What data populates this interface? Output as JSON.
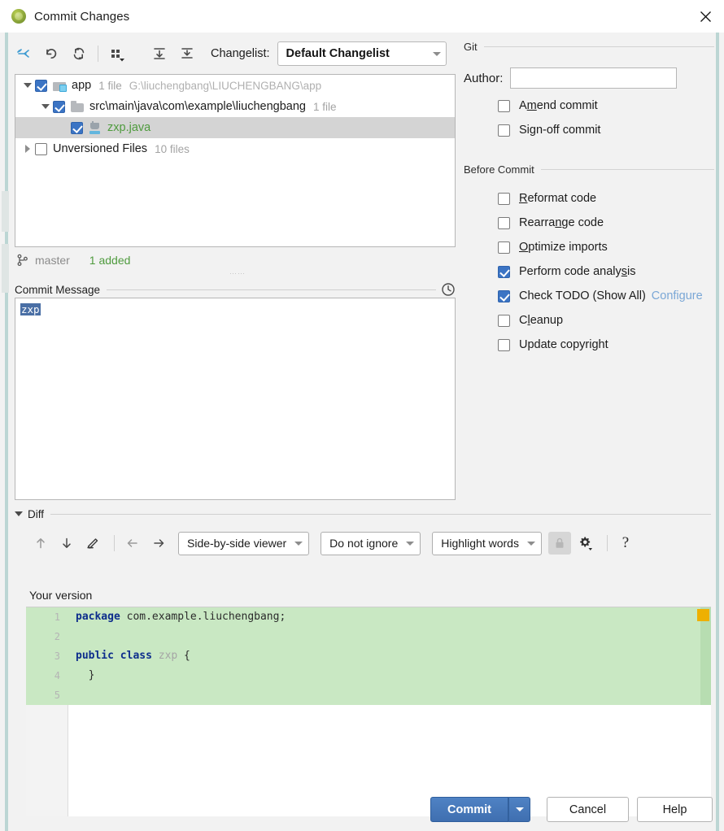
{
  "window": {
    "title": "Commit Changes",
    "app_icon": "intellij-idea-icon",
    "close_icon": "close-icon"
  },
  "toolbar": {
    "buttons": [
      {
        "name": "move-to-another-changelist-icon",
        "tooltip": "Move to Another Changelist"
      },
      {
        "name": "rollback-icon",
        "tooltip": "Rollback"
      },
      {
        "name": "refresh-icon",
        "tooltip": "Refresh"
      },
      {
        "name": "group-by-icon",
        "tooltip": "Group By"
      },
      {
        "name": "expand-all-icon",
        "tooltip": "Expand All"
      },
      {
        "name": "collapse-all-icon",
        "tooltip": "Collapse All"
      }
    ],
    "changelist_label": "Changelist:",
    "changelist_value": "Default Changelist"
  },
  "tree": {
    "rows": [
      {
        "indent": 0,
        "expander": "down",
        "checked": true,
        "icon": "module-folder-icon",
        "name": "app",
        "meta": "1 file",
        "path": "G:\\liuchengbang\\LIUCHENGBANG\\app",
        "selected": false,
        "added": false
      },
      {
        "indent": 1,
        "expander": "down",
        "checked": true,
        "icon": "folder-icon",
        "name": "src\\main\\java\\com\\example\\liuchengbang",
        "meta": "1 file",
        "path": "",
        "selected": false,
        "added": false
      },
      {
        "indent": 2,
        "expander": "none",
        "checked": true,
        "icon": "java-file-icon",
        "name": "zxp.java",
        "meta": "",
        "path": "",
        "selected": true,
        "added": true
      },
      {
        "indent": 0,
        "expander": "right",
        "checked": false,
        "icon": "none",
        "name": "Unversioned Files",
        "meta": "10 files",
        "path": "",
        "selected": false,
        "added": false
      }
    ]
  },
  "branch_status": {
    "icon": "git-branch-icon",
    "branch": "master",
    "added": "1 added"
  },
  "commit_message": {
    "label": "Commit Message",
    "history_icon": "clock-history-icon",
    "value": "zxp",
    "selected": true
  },
  "git_section": {
    "title": "Git",
    "author_label": "Author:",
    "author_value": "",
    "options": [
      {
        "name": "amend-commit",
        "label": "A<u>m</u>end commit",
        "checked": false
      },
      {
        "name": "sign-off-commit",
        "label": "Sign-off commit",
        "checked": false
      }
    ]
  },
  "before_commit_section": {
    "title": "Before Commit",
    "options": [
      {
        "name": "reformat-code",
        "label": "<u>R</u>eformat code",
        "checked": false,
        "link": ""
      },
      {
        "name": "rearrange-code",
        "label": "Rearra<u>n</u>ge code",
        "checked": false,
        "link": ""
      },
      {
        "name": "optimize-imports",
        "label": "<u>O</u>ptimize imports",
        "checked": false,
        "link": ""
      },
      {
        "name": "perform-code-analysis",
        "label": "Perform code analy<u>s</u>is",
        "checked": true,
        "link": ""
      },
      {
        "name": "check-todo",
        "label": "Check TODO (Show All)",
        "checked": true,
        "link": "Configure"
      },
      {
        "name": "cleanup",
        "label": "C<u>l</u>eanup",
        "checked": false,
        "link": ""
      },
      {
        "name": "update-copyright",
        "label": "Update copyright",
        "checked": false,
        "link": ""
      }
    ]
  },
  "diff": {
    "section_title": "Diff",
    "toolbar": {
      "prev_diff_icon": "arrow-up-icon",
      "next_diff_icon": "arrow-down-icon",
      "edit_icon": "pencil-icon",
      "apply_left_icon": "arrow-left-icon",
      "apply_right_icon": "arrow-right-icon",
      "viewer_mode": "Side-by-side viewer",
      "ignore_mode": "Do not ignore",
      "highlight_mode": "Highlight words",
      "lock_icon": "lock-icon",
      "settings_icon": "gear-icon",
      "help_icon": "question-mark-icon"
    },
    "pane_title": "Your version",
    "lines": [
      {
        "num": "1",
        "tokens": [
          {
            "t": "package",
            "c": "kw"
          },
          {
            "t": " com.example.liuchengbang;",
            "c": "plain"
          }
        ],
        "added": true
      },
      {
        "num": "2",
        "tokens": [],
        "added": true
      },
      {
        "num": "3",
        "tokens": [
          {
            "t": "public class",
            "c": "kw"
          },
          {
            "t": " ",
            "c": "plain"
          },
          {
            "t": "zxp",
            "c": "ident"
          },
          {
            "t": " {",
            "c": "plain"
          }
        ],
        "added": true
      },
      {
        "num": "4",
        "tokens": [
          {
            "t": "  }",
            "c": "plain"
          }
        ],
        "added": true
      },
      {
        "num": "5",
        "tokens": [],
        "added": true
      }
    ]
  },
  "footer": {
    "commit_label": "Commit",
    "commit_dropdown_icon": "chevron-down-icon",
    "cancel_label": "Cancel",
    "help_label": "Help"
  },
  "colors": {
    "accent": "#3b74c4",
    "added_green": "#4f9b3e",
    "diff_added_bg": "#c9e8c3",
    "link": "#7aa7d6",
    "marker": "#eeb002"
  }
}
